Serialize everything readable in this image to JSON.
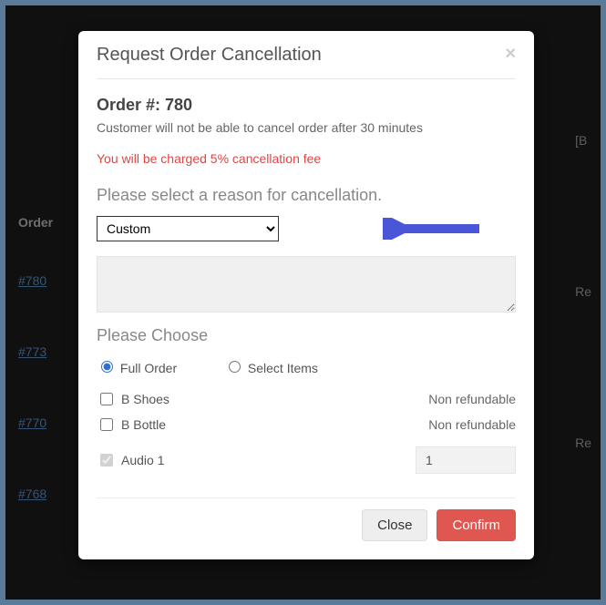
{
  "background": {
    "order_col": "Order",
    "links": [
      "#780",
      "#773",
      "#770",
      "#768"
    ],
    "right_fragments": [
      "[B",
      "Re",
      "Re"
    ]
  },
  "modal": {
    "title": "Request Order Cancellation",
    "close_glyph": "×",
    "order_heading": "Order #: 780",
    "subtext": "Customer will not be able to cancel order after 30 minutes",
    "warning": "You will be charged 5% cancellation fee",
    "reason_label": "Please select a reason for cancellation.",
    "reason_value": "Custom",
    "textarea_value": "",
    "choose_label": "Please Choose",
    "radio": {
      "full": "Full Order",
      "select": "Select Items",
      "selected": "full"
    },
    "items": [
      {
        "label": "B Shoes",
        "checked": false,
        "disabled": false,
        "right_type": "text",
        "right": "Non refundable"
      },
      {
        "label": "B Bottle",
        "checked": false,
        "disabled": false,
        "right_type": "text",
        "right": "Non refundable"
      },
      {
        "label": "Audio 1",
        "checked": true,
        "disabled": true,
        "right_type": "qty",
        "right": "1"
      }
    ],
    "buttons": {
      "close": "Close",
      "confirm": "Confirm"
    }
  }
}
